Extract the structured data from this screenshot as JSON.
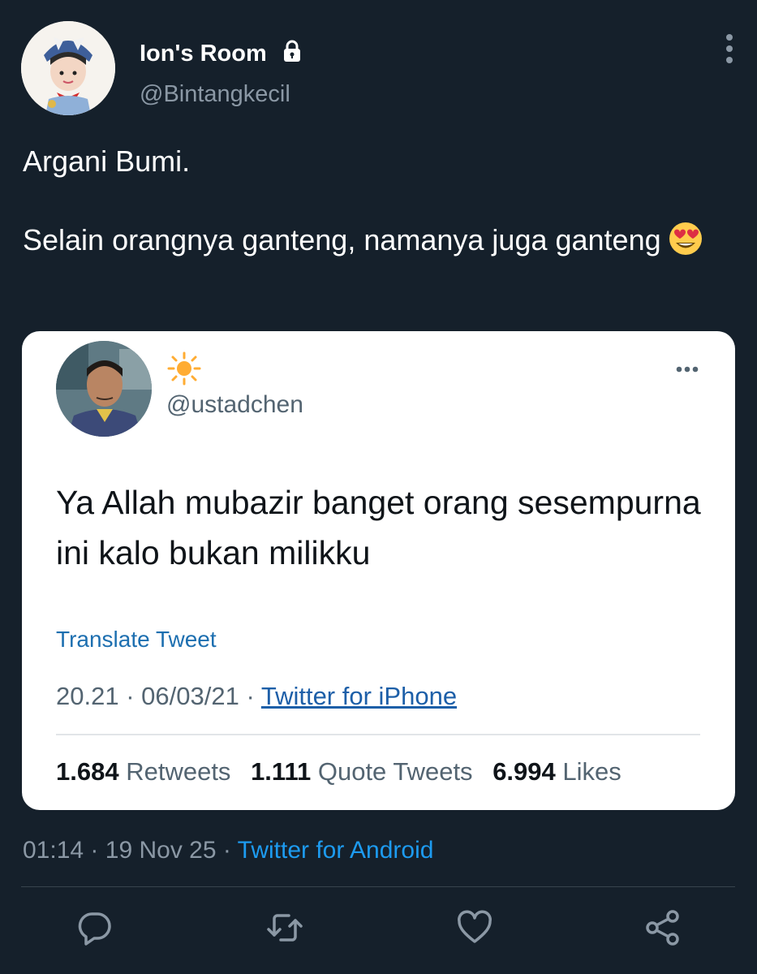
{
  "author": {
    "name": "Ion's Room",
    "handle": "@Bintangkecil",
    "avatar_icon": "child-avatar",
    "protected": true
  },
  "tweet": {
    "paragraphs": [
      "Argani Bumi.",
      "Selain orangnya ganteng, namanya juga ganteng"
    ],
    "emoji": "smiling-face-with-heart-eyes"
  },
  "quoted": {
    "display_name_icon": "sun-emoji",
    "handle": "@ustadchen",
    "text": "Ya Allah mubazir banget orang sesempurna ini kalo bukan milikku",
    "translate_label": "Translate Tweet",
    "time": "20.21",
    "date": "06/03/21",
    "source": "Twitter for iPhone",
    "separator": "·",
    "stats": [
      {
        "value": "1.684",
        "label": "Retweets"
      },
      {
        "value": "1.111",
        "label": "Quote Tweets"
      },
      {
        "value": "6.994",
        "label": "Likes"
      }
    ]
  },
  "meta": {
    "time": "01:14",
    "date": "19 Nov 25",
    "source": "Twitter for Android",
    "separator": "·"
  },
  "actions": [
    "reply-icon",
    "retweet-icon",
    "like-icon",
    "share-icon"
  ],
  "colors": {
    "background": "#15202b",
    "accent": "#1d9bf0",
    "muted": "#8b98a5",
    "card": "#ffffff"
  }
}
